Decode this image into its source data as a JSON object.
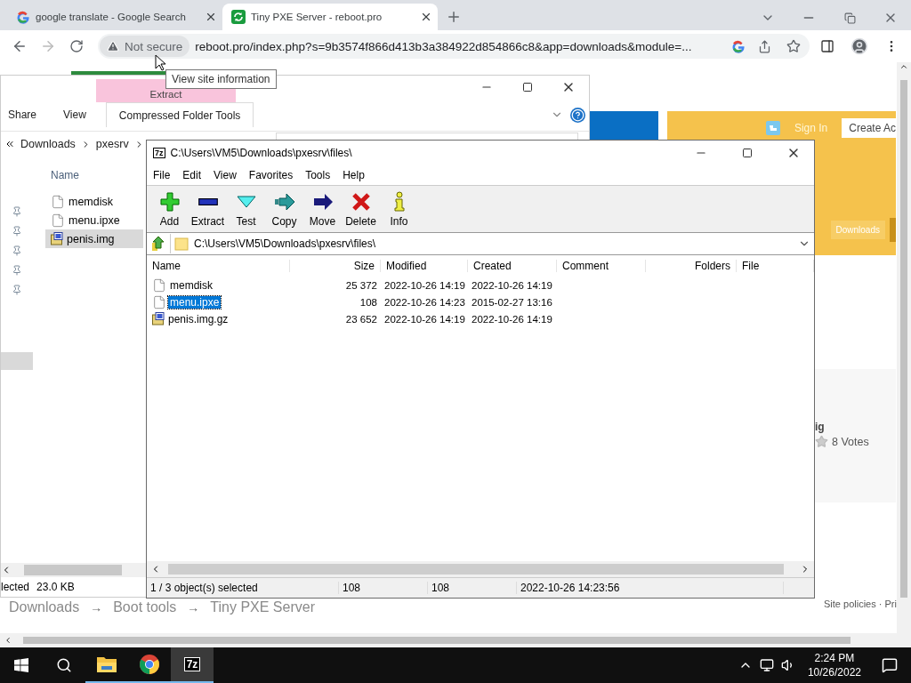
{
  "browser": {
    "tabs": [
      {
        "title": "google translate - Google Search",
        "selected": false,
        "kind": "google"
      },
      {
        "title": "Tiny PXE Server - reboot.pro",
        "selected": true,
        "kind": "site"
      }
    ],
    "security": "Not secure",
    "url": "reboot.pro/index.php?s=9b3574f866d413b3a384922d854866c8&app=downloads&module=...",
    "tooltip": "View site information"
  },
  "webpage": {
    "sign_in": "Sign In",
    "create_account": "Create Ac",
    "nav_button": "Downloads",
    "rating_title": "ig",
    "votes": "8 Votes",
    "breadcrumb": [
      {
        "label": "Downloads",
        "kind": "link"
      },
      {
        "label": "→",
        "kind": "separator"
      },
      {
        "label": "Boot tools",
        "kind": "link"
      },
      {
        "label": "→",
        "kind": "separator"
      },
      {
        "label": "Tiny PXE Server",
        "kind": "link"
      }
    ],
    "footer": "Site policies · Pri"
  },
  "explorer": {
    "context_tab": "Extract",
    "ribbon_tabs": [
      {
        "label": "Share",
        "selected": false
      },
      {
        "label": "View",
        "selected": false
      },
      {
        "label": "Compressed Folder Tools",
        "selected": true
      }
    ],
    "path": [
      "Downloads",
      "pxesrv"
    ],
    "column": "Name",
    "files": [
      {
        "name": "memdisk",
        "selected": false,
        "kind": "file"
      },
      {
        "name": "menu.ipxe",
        "selected": false,
        "kind": "file"
      },
      {
        "name": "penis.img",
        "selected": true,
        "kind": "archive"
      }
    ],
    "status": [
      "lected",
      "23.0 KB"
    ]
  },
  "sevenzip": {
    "icon_text": "7z",
    "title": "C:\\Users\\VM5\\Downloads\\pxesrv\\files\\",
    "menu": [
      "File",
      "Edit",
      "View",
      "Favorites",
      "Tools",
      "Help"
    ],
    "toolbar": [
      {
        "label": "Add",
        "kind": "add"
      },
      {
        "label": "Extract",
        "kind": "extract"
      },
      {
        "label": "Test",
        "kind": "test"
      },
      {
        "label": "Copy",
        "kind": "copy"
      },
      {
        "label": "Move",
        "kind": "move"
      },
      {
        "label": "Delete",
        "kind": "delete"
      },
      {
        "label": "Info",
        "kind": "info"
      }
    ],
    "path": "C:\\Users\\VM5\\Downloads\\pxesrv\\files\\",
    "columns": [
      "Name",
      "Size",
      "Modified",
      "Created",
      "Comment",
      "Folders",
      "File"
    ],
    "rows": [
      {
        "name": "memdisk",
        "size": "25 372",
        "modified": "2022-10-26 14:19",
        "created": "2022-10-26 14:19",
        "selected": false,
        "kind": "file"
      },
      {
        "name": "menu.ipxe",
        "size": "108",
        "modified": "2022-10-26 14:23",
        "created": "2015-02-27 13:16",
        "selected": true,
        "kind": "file"
      },
      {
        "name": "penis.img.gz",
        "size": "23 652",
        "modified": "2022-10-26 14:19",
        "created": "2022-10-26 14:19",
        "selected": false,
        "kind": "archive"
      }
    ],
    "status": [
      "1 / 3 object(s) selected",
      "108",
      "108",
      "2022-10-26 14:23:56"
    ]
  },
  "taskbar": {
    "apps": [
      {
        "kind": "explorer",
        "active": false
      },
      {
        "kind": "chrome",
        "active": false
      },
      {
        "kind": "sevenzip",
        "active": true,
        "label": "7z"
      }
    ],
    "time": "2:24 PM",
    "date": "10/26/2022"
  }
}
